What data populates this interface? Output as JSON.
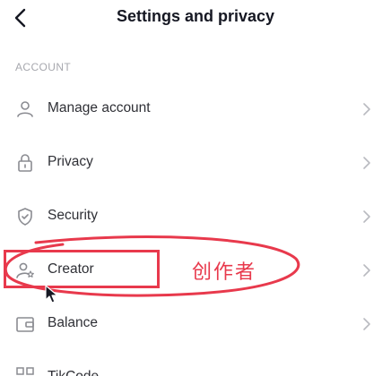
{
  "header": {
    "title": "Settings and privacy",
    "back_icon": "chevron-left-icon"
  },
  "section": {
    "label": "ACCOUNT"
  },
  "menu": {
    "items": [
      {
        "label": "Manage account",
        "icon": "person-icon"
      },
      {
        "label": "Privacy",
        "icon": "lock-icon"
      },
      {
        "label": "Security",
        "icon": "shield-icon"
      },
      {
        "label": "Creator",
        "icon": "creator-icon"
      },
      {
        "label": "Balance",
        "icon": "wallet-icon"
      },
      {
        "label": "TikCode",
        "icon": "qr-code-icon"
      }
    ]
  },
  "annotation": {
    "text": "创作者",
    "color": "#e8394c"
  },
  "colors": {
    "text": "#161823",
    "muted": "#a7a8ae",
    "icon": "#8a8b91",
    "accent": "#e8394c"
  }
}
